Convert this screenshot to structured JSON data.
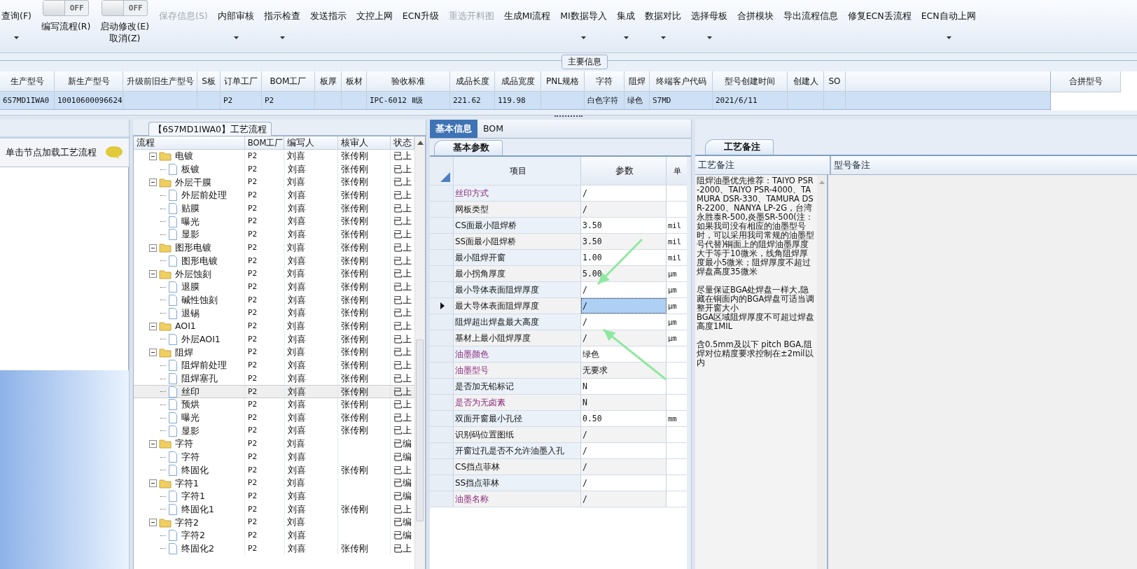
{
  "toolbar": [
    {
      "kind": "button",
      "label": "查询(F)",
      "dropdown": true,
      "disabled": false
    },
    {
      "kind": "toggle",
      "label": "编写流程(R)",
      "toggle": "OFF",
      "on": false,
      "dropdown": false,
      "disabled": false
    },
    {
      "kind": "toggle",
      "label": "启动修改(E)",
      "sub": "取消(Z)",
      "toggle": "OFF",
      "on": false,
      "dropdown": false,
      "disabled": false
    },
    {
      "kind": "button",
      "label": "保存信息(S)",
      "dropdown": false,
      "disabled": true
    },
    {
      "kind": "button",
      "label": "内部审核",
      "dropdown": true,
      "disabled": false
    },
    {
      "kind": "button",
      "label": "指示检查",
      "dropdown": true,
      "disabled": false
    },
    {
      "kind": "button",
      "label": "发送指示",
      "dropdown": false,
      "disabled": false
    },
    {
      "kind": "button",
      "label": "文控上网",
      "dropdown": false,
      "disabled": false
    },
    {
      "kind": "button",
      "label": "ECN升级",
      "dropdown": false,
      "disabled": false
    },
    {
      "kind": "button",
      "label": "重选开料图",
      "dropdown": false,
      "disabled": true
    },
    {
      "kind": "button",
      "label": "生成MI流程",
      "dropdown": false,
      "disabled": false
    },
    {
      "kind": "button",
      "label": "MI数据导入",
      "dropdown": true,
      "disabled": false
    },
    {
      "kind": "button",
      "label": "集成",
      "dropdown": true,
      "disabled": false
    },
    {
      "kind": "button",
      "label": "数据对比",
      "dropdown": true,
      "disabled": false
    },
    {
      "kind": "button",
      "label": "选择母板",
      "dropdown": true,
      "disabled": false
    },
    {
      "kind": "button",
      "label": "合拼模块",
      "dropdown": false,
      "disabled": false
    },
    {
      "kind": "button",
      "label": "导出流程信息",
      "dropdown": false,
      "disabled": false
    },
    {
      "kind": "button",
      "label": "修复ECN丢流程",
      "dropdown": false,
      "disabled": false
    },
    {
      "kind": "button",
      "label": "ECN自动上网",
      "dropdown": true,
      "disabled": false
    }
  ],
  "main_info": {
    "title": "主要信息",
    "columns": [
      "生产型号",
      "新生产型号",
      "升级前旧生产型号",
      "S板",
      "订单工厂",
      "BOM工厂",
      "板厚",
      "板材",
      "验收标准",
      "成品长度",
      "成品宽度",
      "PNL规格",
      "字符",
      "阻焊",
      "终端客户代码",
      "型号创建时间",
      "创建人",
      "SO"
    ],
    "row": {
      "selected": true,
      "cells": [
        "6S7MD1IWA0",
        "10010600096624",
        "",
        "",
        "P2",
        "P2",
        "",
        "",
        "IPC-6012 Ⅱ级",
        "221.62",
        "119.98",
        "",
        "白色字符",
        "绿色",
        "S7MD",
        "2021/6/11",
        "",
        ""
      ]
    },
    "merge_column": "合拼型号"
  },
  "left_panel": {
    "hint": "单击节点加载工艺流程"
  },
  "flow": {
    "title": "【6S7MD1IWA0】工艺流程",
    "columns": [
      "流程",
      "BOM工厂",
      "编写人",
      "核审人",
      "状态"
    ],
    "nodes": [
      {
        "name": "电镀",
        "factory": "P2",
        "writer": "刘喜",
        "reviewer": "张传刚",
        "status": "已上",
        "expanded": true,
        "selected": false,
        "children": [
          {
            "name": "板镀",
            "factory": "P2",
            "writer": "刘喜",
            "reviewer": "张传刚",
            "status": "已上",
            "selected": false
          }
        ]
      },
      {
        "name": "外层干膜",
        "factory": "P2",
        "writer": "刘喜",
        "reviewer": "张传刚",
        "status": "已上",
        "expanded": true,
        "selected": false,
        "children": [
          {
            "name": "外层前处理",
            "factory": "P2",
            "writer": "刘喜",
            "reviewer": "张传刚",
            "status": "已上",
            "selected": false
          },
          {
            "name": "贴膜",
            "factory": "P2",
            "writer": "刘喜",
            "reviewer": "张传刚",
            "status": "已上",
            "selected": false
          },
          {
            "name": "曝光",
            "factory": "P2",
            "writer": "刘喜",
            "reviewer": "张传刚",
            "status": "已上",
            "selected": false
          },
          {
            "name": "显影",
            "factory": "P2",
            "writer": "刘喜",
            "reviewer": "张传刚",
            "status": "已上",
            "selected": false
          }
        ]
      },
      {
        "name": "图形电镀",
        "factory": "P2",
        "writer": "刘喜",
        "reviewer": "张传刚",
        "status": "已上",
        "expanded": true,
        "selected": false,
        "children": [
          {
            "name": "图形电镀",
            "factory": "P2",
            "writer": "刘喜",
            "reviewer": "张传刚",
            "status": "已上",
            "selected": false
          }
        ]
      },
      {
        "name": "外层蚀刻",
        "factory": "P2",
        "writer": "刘喜",
        "reviewer": "张传刚",
        "status": "已上",
        "expanded": true,
        "selected": false,
        "children": [
          {
            "name": "退膜",
            "factory": "P2",
            "writer": "刘喜",
            "reviewer": "张传刚",
            "status": "已上",
            "selected": false
          },
          {
            "name": "碱性蚀刻",
            "factory": "P2",
            "writer": "刘喜",
            "reviewer": "张传刚",
            "status": "已上",
            "selected": false
          },
          {
            "name": "退锡",
            "factory": "P2",
            "writer": "刘喜",
            "reviewer": "张传刚",
            "status": "已上",
            "selected": false
          }
        ]
      },
      {
        "name": "AOI1",
        "factory": "P2",
        "writer": "刘喜",
        "reviewer": "张传刚",
        "status": "已上",
        "expanded": true,
        "selected": false,
        "children": [
          {
            "name": "外层AOI1",
            "factory": "P2",
            "writer": "刘喜",
            "reviewer": "张传刚",
            "status": "已上",
            "selected": false
          }
        ]
      },
      {
        "name": "阻焊",
        "factory": "P2",
        "writer": "刘喜",
        "reviewer": "张传刚",
        "status": "已上",
        "expanded": true,
        "selected": false,
        "children": [
          {
            "name": "阻焊前处理",
            "factory": "P2",
            "writer": "刘喜",
            "reviewer": "张传刚",
            "status": "已上",
            "selected": false
          },
          {
            "name": "阻焊塞孔",
            "factory": "P2",
            "writer": "刘喜",
            "reviewer": "张传刚",
            "status": "已上",
            "selected": false
          },
          {
            "name": "丝印",
            "factory": "P2",
            "writer": "刘喜",
            "reviewer": "张传刚",
            "status": "已上",
            "selected": true
          },
          {
            "name": "预烘",
            "factory": "P2",
            "writer": "刘喜",
            "reviewer": "张传刚",
            "status": "已上",
            "selected": false
          },
          {
            "name": "曝光",
            "factory": "P2",
            "writer": "刘喜",
            "reviewer": "张传刚",
            "status": "已上",
            "selected": false
          },
          {
            "name": "显影",
            "factory": "P2",
            "writer": "刘喜",
            "reviewer": "张传刚",
            "status": "已上",
            "selected": false
          }
        ]
      },
      {
        "name": "字符",
        "factory": "P2",
        "writer": "刘喜",
        "status": "已编",
        "expanded": true,
        "selected": false,
        "children": [
          {
            "name": "字符",
            "factory": "P2",
            "writer": "刘喜",
            "status": "已编",
            "selected": false
          },
          {
            "name": "终固化",
            "factory": "P2",
            "writer": "刘喜",
            "reviewer": "张传刚",
            "status": "已上",
            "selected": false
          }
        ]
      },
      {
        "name": "字符1",
        "factory": "P2",
        "writer": "刘喜",
        "status": "已编",
        "expanded": true,
        "selected": false,
        "children": [
          {
            "name": "字符1",
            "factory": "P2",
            "writer": "刘喜",
            "status": "已编",
            "selected": false
          },
          {
            "name": "终固化1",
            "factory": "P2",
            "writer": "刘喜",
            "reviewer": "张传刚",
            "status": "已上",
            "selected": false
          }
        ]
      },
      {
        "name": "字符2",
        "factory": "P2",
        "writer": "刘喜",
        "status": "已编",
        "expanded": true,
        "selected": false,
        "children": [
          {
            "name": "字符2",
            "factory": "P2",
            "writer": "刘喜",
            "status": "已编",
            "selected": false
          },
          {
            "name": "终固化2",
            "factory": "P2",
            "writer": "刘喜",
            "reviewer": "张传刚",
            "status": "已上",
            "selected": false
          }
        ]
      }
    ]
  },
  "detail": {
    "tabs": [
      {
        "label": "基本信息",
        "selected": true
      },
      {
        "label": "BOM",
        "selected": false
      }
    ],
    "subtab": "基本参数",
    "columns": [
      "项目",
      "参数",
      "单"
    ],
    "rows": [
      {
        "kind": "required",
        "item": "丝印方式",
        "value": "/",
        "unit": "",
        "selected": false
      },
      {
        "kind": "normal",
        "item": "网板类型",
        "value": "/",
        "unit": "",
        "selected": false
      },
      {
        "kind": "normal",
        "item": "CS面最小阻焊桥",
        "value": "3.50",
        "unit": "mil",
        "selected": false
      },
      {
        "kind": "normal",
        "item": "SS面最小阻焊桥",
        "value": "3.50",
        "unit": "mil",
        "selected": false
      },
      {
        "kind": "normal",
        "item": "最小阻焊开窗",
        "value": "1.00",
        "unit": "mil",
        "selected": false
      },
      {
        "kind": "normal",
        "item": "最小拐角厚度",
        "value": "5.00",
        "unit": "μm",
        "selected": false
      },
      {
        "kind": "normal",
        "item": "最小导体表面阻焊厚度",
        "value": "/",
        "unit": "μm",
        "selected": false
      },
      {
        "kind": "normal",
        "item": "最大导体表面阻焊厚度",
        "value": "/",
        "unit": "μm",
        "selected": true
      },
      {
        "kind": "normal",
        "item": "阻焊超出焊盘最大高度",
        "value": "/",
        "unit": "μm",
        "selected": false
      },
      {
        "kind": "normal",
        "item": "基材上最小阻焊厚度",
        "value": "/",
        "unit": "μm",
        "selected": false
      },
      {
        "kind": "required",
        "item": "油墨颜色",
        "value": "绿色",
        "unit": "",
        "selected": false
      },
      {
        "kind": "required",
        "item": "油墨型号",
        "value": "无要求",
        "unit": "",
        "selected": false
      },
      {
        "kind": "normal",
        "item": "是否加无铅标记",
        "value": "N",
        "unit": "",
        "selected": false
      },
      {
        "kind": "required",
        "item": "是否为无卤素",
        "value": "N",
        "unit": "",
        "selected": false
      },
      {
        "kind": "normal",
        "item": "双面开窗最小孔径",
        "value": "0.50",
        "unit": "mm",
        "selected": false
      },
      {
        "kind": "normal",
        "item": "识别码位置图纸",
        "value": "/",
        "unit": "",
        "selected": false
      },
      {
        "kind": "normal",
        "item": "开窗过孔是否不允许油墨入孔",
        "value": "/",
        "unit": "",
        "selected": false
      },
      {
        "kind": "normal",
        "item": "CS挡点菲林",
        "value": "/",
        "unit": "",
        "selected": false
      },
      {
        "kind": "normal",
        "item": "SS挡点菲林",
        "value": "/",
        "unit": "",
        "selected": false
      },
      {
        "kind": "required",
        "item": "油墨名称",
        "value": "/",
        "unit": "",
        "selected": false
      }
    ]
  },
  "annotations": [
    {
      "kind": "arrow"
    },
    {
      "kind": "arrow"
    }
  ],
  "remarks": {
    "tab": "工艺备注",
    "columns": [
      "工艺备注",
      "型号备注"
    ],
    "process_notes": [
      "阻焊油墨优先推荐：TAIYO PSR-2000、TAIYO PSR-4000、TAMURA DSR-330、TAMURA DSR-2200、NANYA LP-2G，台湾永胜泰R-500,炎墨SR-500(注：如果我司没有相应的油墨型号时，可以采用我司常规的油墨型号代替)铜面上的阻焊油墨厚度大于等于10微米，线角阻焊厚度最小5微米；阻焊厚度不超过焊盘高度35微米",
      "尽量保证BGA处焊盘一样大,隐藏在铜面内的BGA焊盘可适当调整开窗大小\nBGA区域阻焊厚度不可超过焊盘高度1MIL",
      "含0.5mm及以下 pitch BGA,阻焊对位精度要求控制在±2mil以内"
    ]
  }
}
